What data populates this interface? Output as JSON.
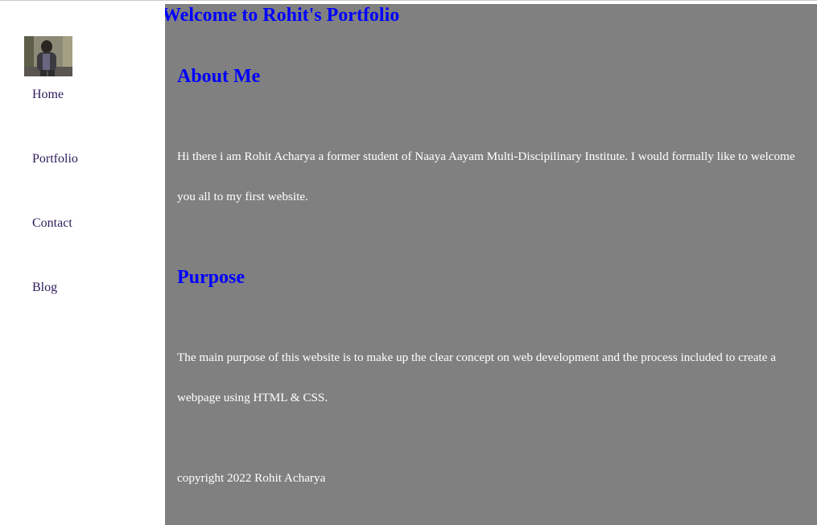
{
  "sidebar": {
    "avatar": {
      "icon": "profile-photo"
    },
    "nav": [
      {
        "label": "Home"
      },
      {
        "label": "Portfolio"
      },
      {
        "label": "Contact"
      },
      {
        "label": "Blog"
      }
    ],
    "link_color": "#2d1b5c"
  },
  "main": {
    "background": "#808080",
    "title": "Welcome to Rohit's Portfolio",
    "about": {
      "heading": "About Me",
      "text": "Hi there i am Rohit Acharya a former student of Naaya Aayam Multi-Discipilinary Institute. I would formally like to welcome you all to my first website."
    },
    "purpose": {
      "heading": "Purpose",
      "text": "The main purpose of this website is to make up the clear concept on web development and the process included to create a webpage using HTML & CSS."
    },
    "footer": {
      "text": "copyright 2022 Rohit Acharya"
    },
    "heading_color": "#0000ff",
    "text_color": "#ffffff"
  }
}
